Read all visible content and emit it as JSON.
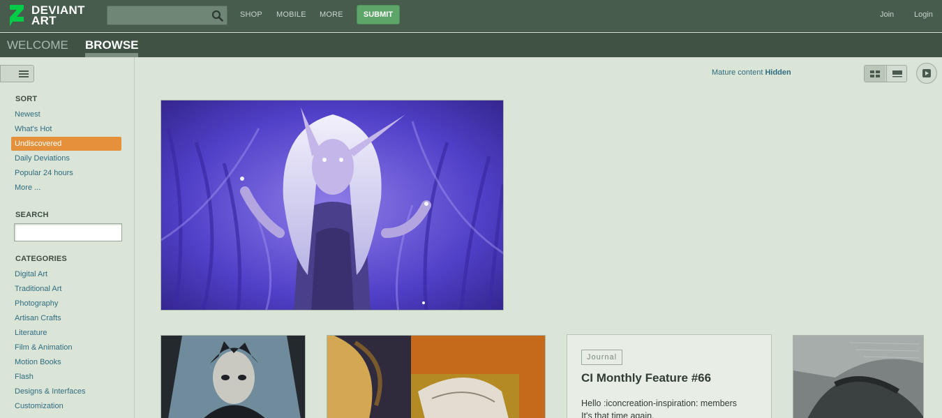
{
  "header": {
    "logo_line1": "DEVIANT",
    "logo_line2": "ART",
    "search_value": "",
    "nav": [
      "SHOP",
      "MOBILE",
      "MORE"
    ],
    "submit_label": "SUBMIT",
    "join_label": "Join",
    "login_label": "Login"
  },
  "tabs": [
    {
      "label": "WELCOME"
    },
    {
      "label": "BROWSE"
    }
  ],
  "sidebar": {
    "sort_heading": "SORT",
    "sort_items": [
      "Newest",
      "What's Hot",
      "Undiscovered",
      "Daily Deviations",
      "Popular 24 hours",
      "More ..."
    ],
    "sort_selected": "Undiscovered",
    "search_heading": "SEARCH",
    "search_value": "",
    "categories_heading": "CATEGORIES",
    "categories": [
      "Digital Art",
      "Traditional Art",
      "Photography",
      "Artisan Crafts",
      "Literature",
      "Film & Animation",
      "Motion Books",
      "Flash",
      "Designs & Interfaces",
      "Customization"
    ]
  },
  "main": {
    "mature_label": "Mature content",
    "mature_state": "Hidden",
    "journal": {
      "badge": "Journal",
      "title": "CI Monthly Feature #66",
      "body_line1": "Hello :iconcreation-inspiration: members",
      "body_line2": "It's that time again."
    }
  },
  "colors": {
    "topbar": "#475c4d",
    "tabbar": "#3f5244",
    "accent_green": "#5da568",
    "selected_orange": "#e5913b",
    "link": "#2f6c80",
    "page_bg": "#dae4d7"
  },
  "icons": {
    "logo": "deviantart-z-icon",
    "search": "search-icon",
    "menu": "hamburger-icon",
    "grid_view": "grid-view-icon",
    "list_view": "list-view-icon",
    "slideshow": "play-icon"
  }
}
